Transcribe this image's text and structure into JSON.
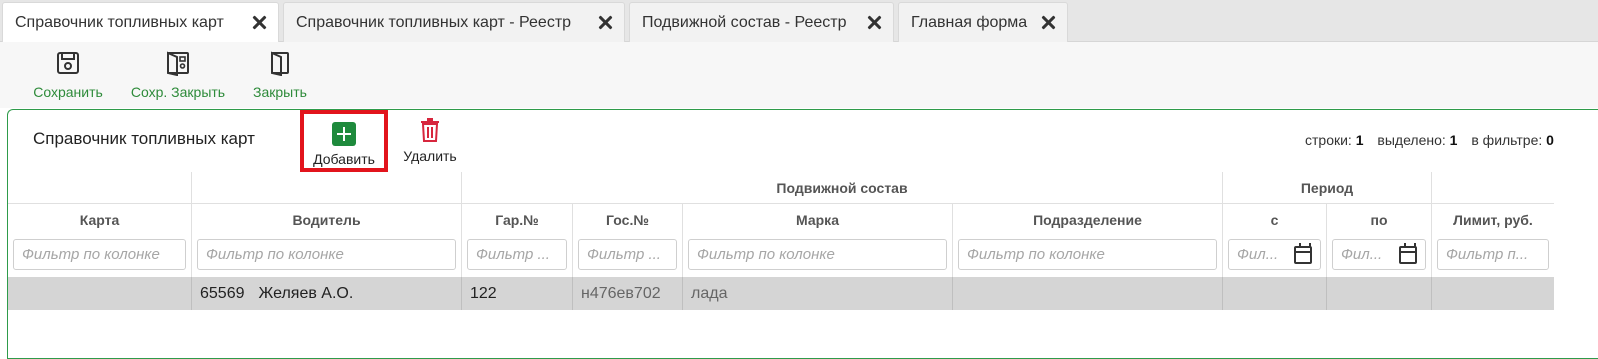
{
  "tabs": [
    {
      "label": "Справочник топливных карт",
      "active": true
    },
    {
      "label": "Справочник топливных карт - Реестр",
      "active": false
    },
    {
      "label": "Подвижной состав - Реестр",
      "active": false
    },
    {
      "label": "Главная форма",
      "active": false
    }
  ],
  "toolbar": {
    "save_label": "Сохранить",
    "save_close_label": "Сохр. Закрыть",
    "close_label": "Закрыть"
  },
  "panel": {
    "title": "Справочник топливных карт",
    "add_label": "Добавить",
    "delete_label": "Удалить",
    "stats": {
      "rows_label": "строки:",
      "rows_value": "1",
      "selected_label": "выделено:",
      "selected_value": "1",
      "filter_label": "в фильтре:",
      "filter_value": "0"
    }
  },
  "grid": {
    "group_headers": {
      "rolling_stock": "Подвижной состав",
      "period": "Период"
    },
    "columns": {
      "card": "Карта",
      "driver": "Водитель",
      "garage_no": "Гар.№",
      "gov_no": "Гос.№",
      "brand": "Марка",
      "division": "Подразделение",
      "from": "с",
      "to": "по",
      "limit": "Лимит, руб."
    },
    "filters": {
      "card": "Фильтр по колонке",
      "driver": "Фильтр по колонке",
      "garage_no": "Фильтр ...",
      "gov_no": "Фильтр ...",
      "brand": "Фильтр по колонке",
      "division": "Фильтр по колонке",
      "from": "Фил...",
      "to": "Фил...",
      "limit": "Фильтр п..."
    },
    "rows": [
      {
        "card": "",
        "driver_code": "65569",
        "driver_name": "Желяев А.О.",
        "garage_no": "122",
        "gov_no": "н476ев702",
        "brand": "лада",
        "division": "",
        "from": "",
        "to": "",
        "limit": ""
      }
    ]
  },
  "colors": {
    "accent_green": "#2e8b3a",
    "panel_border": "#2e9b4a",
    "highlight_red": "#e2141c",
    "delete_red": "#d7263d"
  }
}
